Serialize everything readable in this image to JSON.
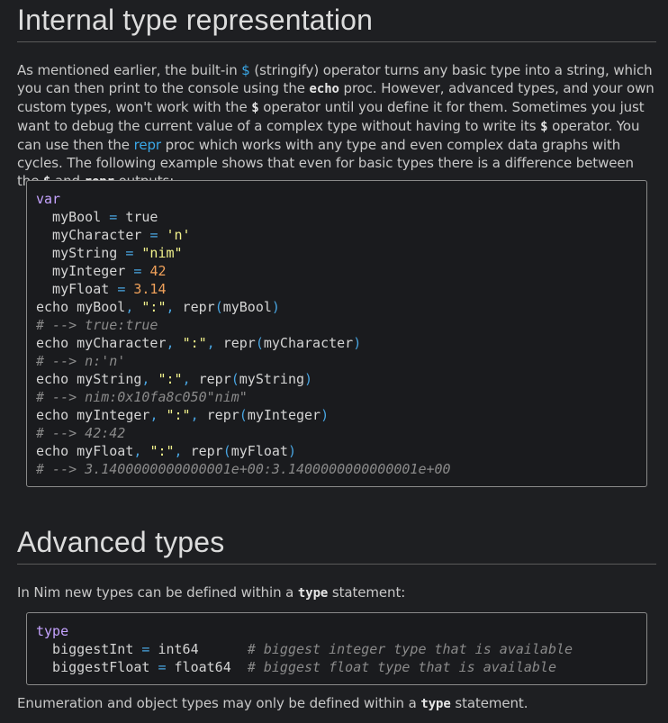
{
  "section1": {
    "heading": "Internal type representation",
    "paragraph": {
      "t1": "As mentioned earlier, the built-in ",
      "dollar": "$",
      "t2": " (stringify) operator turns any basic type into a string, which you can then print to the console using the ",
      "echo": "echo",
      "t3": " proc. However, advanced types, and your own custom types, won't work with the ",
      "dollar2": "$",
      "t4": " operator until you define it for them. Sometimes you just want to debug the current value of a complex type without having to write its ",
      "dollar3": "$",
      "t5": " operator. You can use then the ",
      "repr_link": "repr",
      "t6": " proc which works with any type and even complex data graphs with cycles. The following example shows that even for basic types there is a difference between the ",
      "dollar4": "$",
      "t7": " and ",
      "repr_code": "repr",
      "t8": " outputs:"
    },
    "code_lines": [
      "var",
      "  myBool = true",
      "  myCharacter = 'n'",
      "  myString = \"nim\"",
      "  myInteger = 42",
      "  myFloat = 3.14",
      "echo myBool, \":\", repr(myBool)",
      "# --> true:true",
      "echo myCharacter, \":\", repr(myCharacter)",
      "# --> n:'n'",
      "echo myString, \":\", repr(myString)",
      "# --> nim:0x10fa8c050\"nim\"",
      "echo myInteger, \":\", repr(myInteger)",
      "# --> 42:42",
      "echo myFloat, \":\", repr(myFloat)",
      "# --> 3.1400000000000001e+00:3.1400000000000001e+00"
    ]
  },
  "section2": {
    "heading": "Advanced types",
    "intro_t1": "In Nim new types can be defined within a ",
    "intro_code": "type",
    "intro_t2": " statement:",
    "code_lines": [
      "type",
      "  biggestInt = int64      # biggest integer type that is available",
      "  biggestFloat = float64  # biggest float type that is available"
    ],
    "outro_t1": "Enumeration and object types may only be defined within a ",
    "outro_code": "type",
    "outro_t2": " statement."
  },
  "colors": {
    "background": "#1e1f22",
    "link": "#3aa8e8",
    "string": "#f3f38c",
    "number": "#f0a15a",
    "comment": "#8a8a8a"
  }
}
